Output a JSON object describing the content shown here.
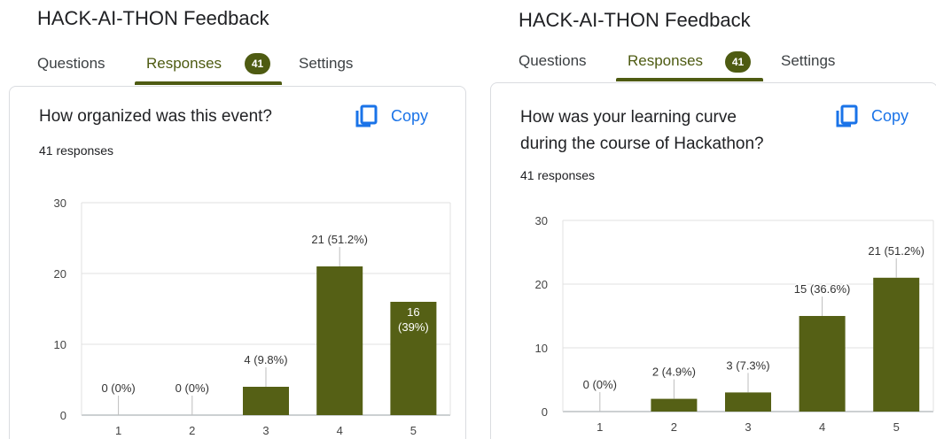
{
  "colors": {
    "accent": "#4e5b12",
    "bar": "#556015",
    "link": "#1a73e8"
  },
  "panels": [
    {
      "form_title": "HACK-AI-THON Feedback",
      "tabs": {
        "questions": "Questions",
        "responses": "Responses",
        "responses_count": "41",
        "settings": "Settings"
      },
      "question": {
        "text": "How organized was this event?",
        "responses": "41 responses",
        "copy_label": "Copy"
      }
    },
    {
      "form_title": "HACK-AI-THON Feedback",
      "tabs": {
        "questions": "Questions",
        "responses": "Responses",
        "responses_count": "41",
        "settings": "Settings"
      },
      "question": {
        "text_line1": "How was your learning curve",
        "text_line2": "during the course of Hackathon?",
        "responses": "41 responses",
        "copy_label": "Copy"
      }
    }
  ],
  "chart_data": [
    {
      "type": "bar",
      "categories": [
        "1",
        "2",
        "3",
        "4",
        "5"
      ],
      "values": [
        0,
        0,
        4,
        21,
        16
      ],
      "data_labels": [
        "0 (0%)",
        "0 (0%)",
        "4 (9.8%)",
        "21 (51.2%)",
        "16 (39%)"
      ],
      "yticks": [
        0,
        10,
        20,
        30
      ],
      "ylim": [
        0,
        30
      ],
      "grid": true
    },
    {
      "type": "bar",
      "categories": [
        "1",
        "2",
        "3",
        "4",
        "5"
      ],
      "values": [
        0,
        2,
        3,
        15,
        21
      ],
      "data_labels": [
        "0 (0%)",
        "2 (4.9%)",
        "3 (7.3%)",
        "15 (36.6%)",
        "21 (51.2%)"
      ],
      "yticks": [
        0,
        10,
        20,
        30
      ],
      "ylim": [
        0,
        30
      ],
      "grid": true
    }
  ]
}
